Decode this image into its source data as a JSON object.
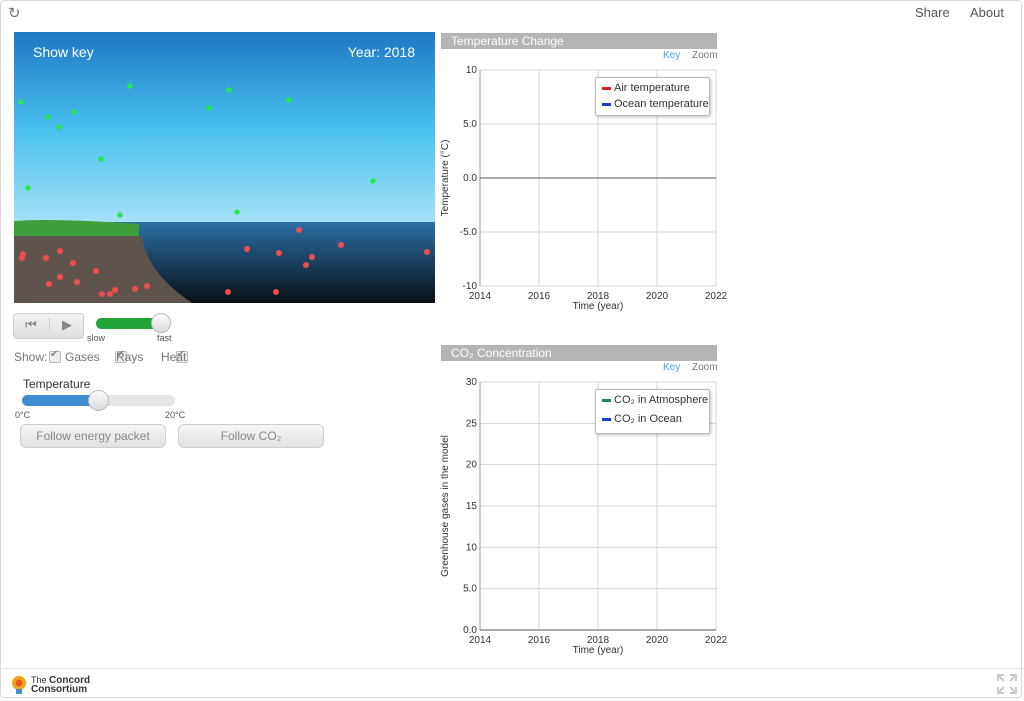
{
  "topbar": {
    "share_label": "Share",
    "about_label": "About"
  },
  "simulation": {
    "show_key_label": "Show key",
    "year_text": "Year: 2018"
  },
  "controls": {
    "speed_slow": "slow",
    "speed_fast": "fast",
    "speed_level": 1.0,
    "show_label": "Show:",
    "show_items": [
      {
        "label": "Gases",
        "checked": true
      },
      {
        "label": "Rays",
        "checked": true
      },
      {
        "label": "Heat",
        "checked": true
      }
    ],
    "temperature_label": "Temperature",
    "temperature_min": "0°C",
    "temperature_max": "20°C",
    "temperature_fraction": 0.5,
    "follow_energy_label": "Follow energy packet",
    "follow_co2_label": "Follow CO₂"
  },
  "charts": [
    {
      "title": "Temperature Change",
      "key_label": "Key",
      "zoom_label": "Zoom",
      "legend": [
        {
          "name": "Air temperature",
          "color": "#dd2222"
        },
        {
          "name": "Ocean temperature",
          "color": "#1a3fd9"
        }
      ]
    },
    {
      "title": "CO₂ Concentration",
      "key_label": "Key",
      "zoom_label": "Zoom",
      "legend": [
        {
          "name": "CO₂ in Atmosphere",
          "color": "#178c52"
        },
        {
          "name": "CO₂ in Ocean",
          "color": "#1a3fd9"
        }
      ]
    }
  ],
  "chart_data": [
    {
      "type": "line",
      "title": "Temperature Change",
      "xlabel": "Time (year)",
      "ylabel": "Temperature (°C)",
      "xlim": [
        2014,
        2022
      ],
      "ylim": [
        -10,
        10
      ],
      "x_ticks": [
        "2014",
        "2016",
        "2018",
        "2020",
        "2022"
      ],
      "y_ticks": [
        "10",
        "5.0",
        "0.0",
        "-5.0",
        "-10"
      ],
      "grid": true,
      "legend_position": "top-right",
      "series": [
        {
          "name": "Air temperature",
          "color": "#dd2222",
          "x": [],
          "y": []
        },
        {
          "name": "Ocean temperature",
          "color": "#1a3fd9",
          "x": [],
          "y": []
        }
      ]
    },
    {
      "type": "line",
      "title": "CO₂ Concentration",
      "xlabel": "Time (year)",
      "ylabel": "Greenhouse gases in the model",
      "xlim": [
        2014,
        2022
      ],
      "ylim": [
        0,
        30
      ],
      "x_ticks": [
        "2014",
        "2016",
        "2018",
        "2020",
        "2022"
      ],
      "y_ticks": [
        "30",
        "25",
        "20",
        "15",
        "10",
        "5.0",
        "0.0"
      ],
      "grid": true,
      "legend_position": "top-right",
      "series": [
        {
          "name": "CO₂ in Atmosphere",
          "color": "#178c52",
          "x": [],
          "y": []
        },
        {
          "name": "CO₂ in Ocean",
          "color": "#1a3fd9",
          "x": [],
          "y": []
        }
      ]
    }
  ],
  "footer": {
    "logo_line1": "The",
    "logo_line2": "Concord",
    "logo_line3": "Consortium"
  }
}
